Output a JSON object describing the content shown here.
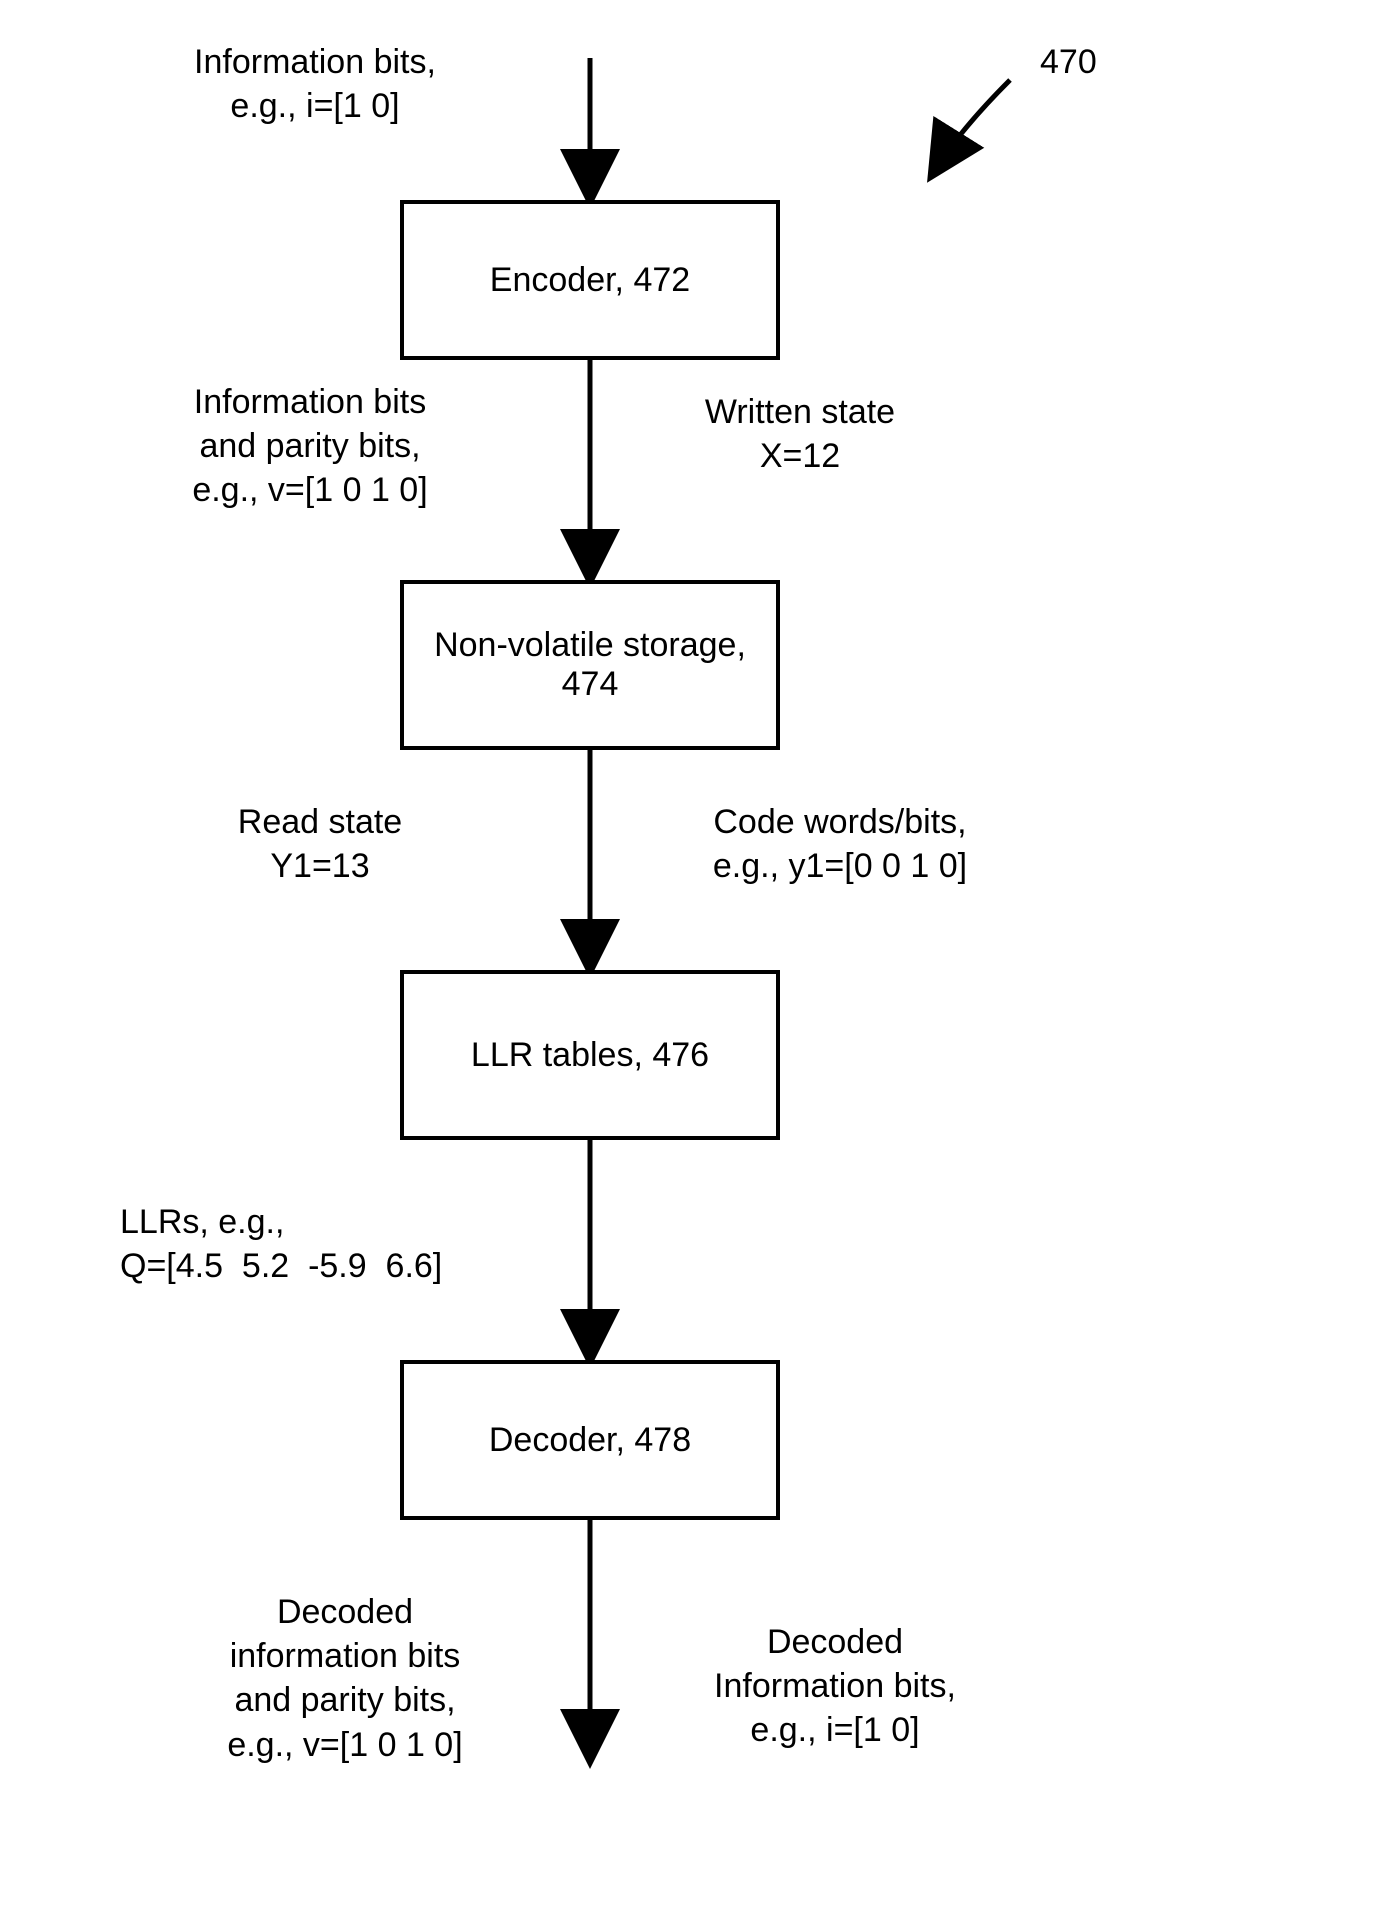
{
  "figure_ref": "470",
  "input_label": "Information bits,\ne.g., i=[1 0]",
  "boxes": {
    "encoder": "Encoder, 472",
    "storage": "Non-volatile\nstorage, 474",
    "llr": "LLR tables,\n476",
    "decoder": "Decoder, 478"
  },
  "edge_labels": {
    "enc_to_storage_left": "Information bits\nand parity bits,\ne.g., v=[1 0 1 0]",
    "enc_to_storage_right": "Written state\nX=12",
    "storage_to_llr_left": "Read state\nY1=13",
    "storage_to_llr_right": "Code words/bits,\ne.g., y1=[0 0 1 0]",
    "llr_to_decoder_left": "LLRs, e.g.,\nQ=[4.5  5.2  -5.9  6.6]",
    "output_left": "Decoded\ninformation bits\nand parity bits,\ne.g., v=[1 0 1 0]",
    "output_right": "Decoded\nInformation bits,\ne.g., i=[1 0]"
  }
}
